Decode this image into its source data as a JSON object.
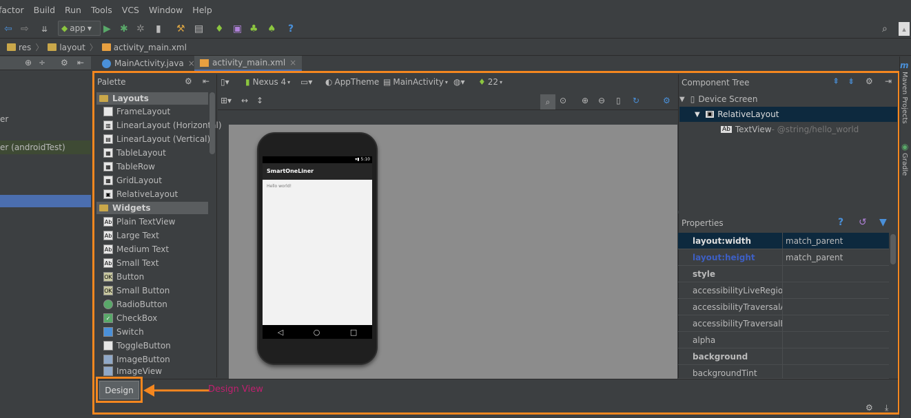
{
  "menu": [
    "factor",
    "Build",
    "Run",
    "Tools",
    "VCS",
    "Window",
    "Help"
  ],
  "toolbar": {
    "run_config": "app",
    "help_icon": "?"
  },
  "breadcrumbs": [
    "res",
    "layout",
    "activity_main.xml"
  ],
  "left_panel": {
    "item1": "er",
    "item2": "er (androidTest)"
  },
  "tabs": [
    {
      "label": "MainActivity.java"
    },
    {
      "label": "activity_main.xml"
    }
  ],
  "palette": {
    "title": "Palette",
    "categories": [
      {
        "label": "Layouts",
        "items": [
          "FrameLayout",
          "LinearLayout (Horizontal)",
          "LinearLayout (Vertical)",
          "TableLayout",
          "TableRow",
          "GridLayout",
          "RelativeLayout"
        ]
      },
      {
        "label": "Widgets",
        "items": [
          "Plain TextView",
          "Large Text",
          "Medium Text",
          "Small Text",
          "Button",
          "Small Button",
          "RadioButton",
          "CheckBox",
          "Switch",
          "ToggleButton",
          "ImageButton",
          "ImageView"
        ]
      }
    ]
  },
  "design_toolbar": {
    "device": "Nexus 4",
    "theme": "AppTheme",
    "activity": "MainActivity",
    "api": "22"
  },
  "phone": {
    "status_time": "5:10",
    "app_title": "SmartOneLiner",
    "body_text": "Hello world!"
  },
  "component_tree": {
    "title": "Component Tree",
    "nodes": [
      "Device Screen",
      "RelativeLayout",
      "TextView"
    ],
    "textview_hint": " - @string/hello_world"
  },
  "properties": {
    "title": "Properties",
    "rows": [
      {
        "k": "layout:width",
        "v": "match_parent"
      },
      {
        "k": "layout:height",
        "v": "match_parent"
      },
      {
        "k": "style",
        "v": ""
      },
      {
        "k": "accessibilityLiveRegion",
        "v": ""
      },
      {
        "k": "accessibilityTraversalAfte",
        "v": ""
      },
      {
        "k": "accessibilityTraversalBefc",
        "v": ""
      },
      {
        "k": "alpha",
        "v": ""
      },
      {
        "k": "background",
        "v": ""
      },
      {
        "k": "backgroundTint",
        "v": ""
      }
    ]
  },
  "bottom": {
    "design_label": "Design",
    "annotation": "Design View"
  },
  "right_strip": {
    "maven": "Maven Projects",
    "gradle": "Gradle"
  },
  "colors": {
    "accent": "#f5871f",
    "annotation": "#c0206f",
    "selection": "#0d293e"
  }
}
